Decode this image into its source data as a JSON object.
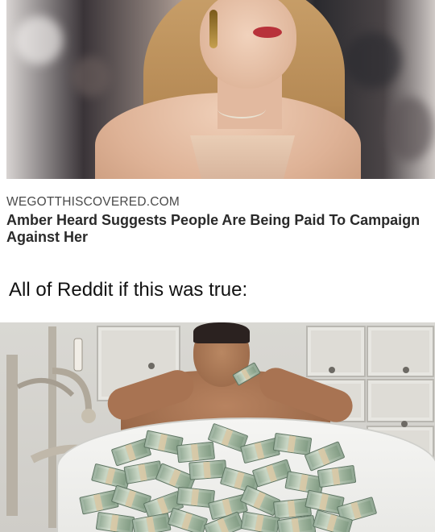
{
  "news_card": {
    "source": "WEGOTTHISCOVERED.COM",
    "headline": "Amber Heard Suggests People Are Being Paid To Campaign Against Her"
  },
  "meme": {
    "caption": "All of Reddit if this was true:"
  },
  "colors": {
    "source_text": "#4a4a4a",
    "headline_text": "#2a2a2a",
    "caption_text": "#111111",
    "background": "#ffffff"
  }
}
